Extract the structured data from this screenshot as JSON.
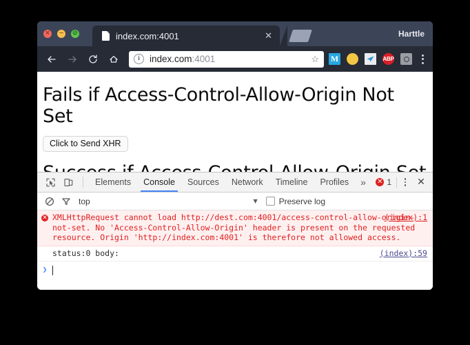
{
  "window": {
    "user_label": "Harttle",
    "traffic_lights": [
      {
        "name": "close",
        "glyph": "✕"
      },
      {
        "name": "minimize",
        "glyph": "−"
      },
      {
        "name": "maximize",
        "glyph": "⊘"
      }
    ]
  },
  "tab": {
    "title": "index.com:4001",
    "close_glyph": "✕",
    "favicon": "page-icon"
  },
  "toolbar": {
    "back": "back-arrow-icon",
    "forward": "forward-arrow-icon",
    "reload": "reload-icon",
    "home": "home-icon",
    "omnibox": {
      "info_glyph": "i",
      "url_host": "index.com",
      "url_port": ":4001",
      "star_glyph": "☆"
    },
    "extensions": [
      {
        "name": "mega-extension",
        "label": "M",
        "color": "#27a8e0"
      },
      {
        "name": "yellow-dot-extension",
        "label": "",
        "color": "#f2c744"
      },
      {
        "name": "send-extension",
        "label": "",
        "color": "#e9ebee"
      },
      {
        "name": "adblock-plus-extension",
        "label": "ABP",
        "color": "#d91f26"
      },
      {
        "name": "camera-extension",
        "label": "",
        "color": "#9a9ea4"
      }
    ],
    "menu": "chrome-menu-icon"
  },
  "page": {
    "heading_1": "Fails if Access-Control-Allow-Origin Not Set",
    "button_label": "Click to Send XHR",
    "heading_2": "Success if Access-Control-Allow-Origin Set to Wildcard"
  },
  "devtools": {
    "inspect_icon": "inspect-element-icon",
    "device_icon": "device-toolbar-icon",
    "tabs": [
      {
        "label": "Elements",
        "active": false
      },
      {
        "label": "Console",
        "active": true
      },
      {
        "label": "Sources",
        "active": false
      },
      {
        "label": "Network",
        "active": false
      },
      {
        "label": "Timeline",
        "active": false
      },
      {
        "label": "Profiles",
        "active": false
      }
    ],
    "more_tabs_glyph": "»",
    "error_badge": {
      "icon_glyph": "✕",
      "count": "1",
      "color": "#e02020"
    },
    "settings_icon": "vertical-dots-icon",
    "close_glyph": "✕",
    "filterbar": {
      "clear_icon": "no-entry-clear-console-icon",
      "filter_icon": "funnel-filter-icon",
      "context": "top",
      "caret_glyph": "▼",
      "preserve_log_label": "Preserve log",
      "preserve_log_checked": false
    },
    "messages": [
      {
        "type": "error",
        "icon": "error-circle-icon",
        "text": "XMLHttpRequest cannot load http://dest.com:4001/access-control-allow-origin-not-set. No 'Access-Control-Allow-Origin' header is present on the requested resource. Origin 'http://index.com:4001' is therefore not allowed access.",
        "link": "(index):1"
      },
      {
        "type": "log",
        "icon": "",
        "text": "status:0 body:",
        "link": "(index):59"
      }
    ],
    "prompt_glyph": "❯"
  }
}
